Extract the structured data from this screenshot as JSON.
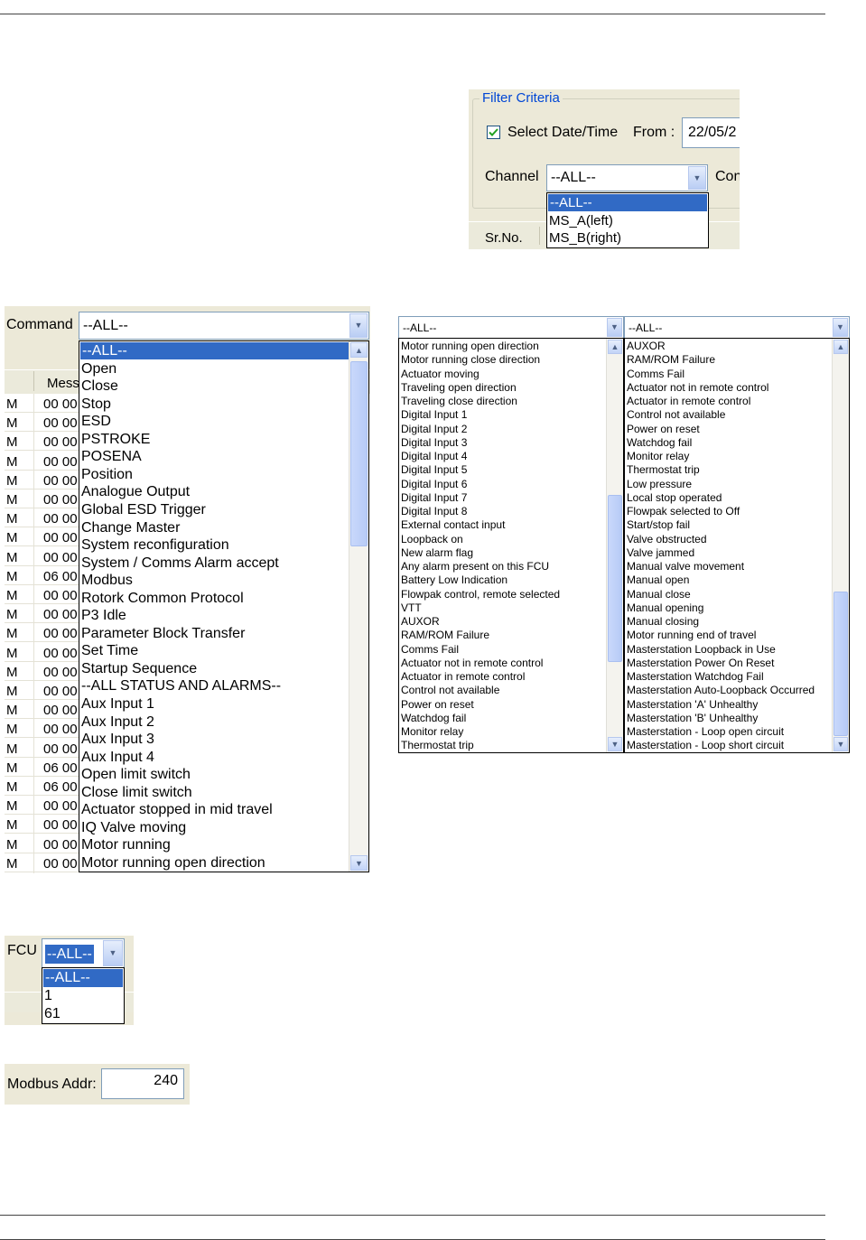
{
  "filter_panel": {
    "group_title": "Filter Criteria",
    "select_date_time_label": "Select Date/Time",
    "select_date_time_checked": true,
    "from_label": "From :",
    "from_value": "22/05/2",
    "channel_label": "Channel",
    "channel_value": "--ALL--",
    "next_label_partial": "Con",
    "channel_options": [
      "--ALL--",
      "MS_A(left)",
      "MS_B(right)"
    ],
    "channel_selected": 0,
    "column_header": "Sr.No."
  },
  "command_panel": {
    "label": "Command",
    "value": "--ALL--",
    "column_header": "Mess",
    "grid_rows": [
      {
        "c1": "M",
        "c2": "00 00"
      },
      {
        "c1": "M",
        "c2": "00 00"
      },
      {
        "c1": "M",
        "c2": "00 00"
      },
      {
        "c1": "M",
        "c2": "00 00"
      },
      {
        "c1": "M",
        "c2": "00 00"
      },
      {
        "c1": "M",
        "c2": "00 00"
      },
      {
        "c1": "M",
        "c2": "00 00"
      },
      {
        "c1": "M",
        "c2": "00 00"
      },
      {
        "c1": "M",
        "c2": "00 00"
      },
      {
        "c1": "M",
        "c2": "06 00"
      },
      {
        "c1": "M",
        "c2": "00 00"
      },
      {
        "c1": "M",
        "c2": "00 00"
      },
      {
        "c1": "M",
        "c2": "00 00"
      },
      {
        "c1": "M",
        "c2": "00 00"
      },
      {
        "c1": "M",
        "c2": "00 00"
      },
      {
        "c1": "M",
        "c2": "00 00"
      },
      {
        "c1": "M",
        "c2": "00 00"
      },
      {
        "c1": "M",
        "c2": "00 00"
      },
      {
        "c1": "M",
        "c2": "00 00"
      },
      {
        "c1": "M",
        "c2": "06 00"
      },
      {
        "c1": "M",
        "c2": "06 00"
      },
      {
        "c1": "M",
        "c2": "00 00"
      },
      {
        "c1": "M",
        "c2": "00 00"
      },
      {
        "c1": "M",
        "c2": "00 00"
      },
      {
        "c1": "M",
        "c2": "00 00"
      }
    ],
    "options": [
      "--ALL--",
      "Open",
      "Close",
      "Stop",
      "ESD",
      "PSTROKE",
      "POSENA",
      "Position",
      "Analogue Output",
      "Global ESD Trigger",
      "Change Master",
      "System reconfiguration",
      "System / Comms Alarm accept",
      "Modbus",
      "Rotork Common Protocol",
      "P3 Idle",
      "Parameter Block Transfer",
      "Set Time",
      "Startup Sequence",
      "--ALL STATUS AND ALARMS--",
      "Aux Input 1",
      "Aux Input 2",
      "Aux Input 3",
      "Aux Input 4",
      "Open limit switch",
      "Close limit switch",
      "Actuator stopped in mid travel",
      "IQ Valve moving",
      "Motor running",
      "Motor running open direction"
    ],
    "selected": 0
  },
  "status_list_1": {
    "value": "--ALL--",
    "options": [
      "Motor running open direction",
      "Motor running close direction",
      "Actuator moving",
      "Traveling open direction",
      "Traveling close direction",
      "Digital Input 1",
      "Digital Input 2",
      "Digital Input 3",
      "Digital Input 4",
      "Digital Input 5",
      "Digital Input 6",
      "Digital Input 7",
      "Digital Input 8",
      "External contact input",
      "Loopback on",
      "New alarm flag",
      "Any alarm present on this FCU",
      "Battery Low Indication",
      "Flowpak control, remote selected",
      "VTT",
      "AUXOR",
      "RAM/ROM Failure",
      "Comms Fail",
      "Actuator not in remote control",
      "Actuator in remote control",
      "Control not available",
      "Power on reset",
      "Watchdog fail",
      "Monitor relay",
      "Thermostat trip"
    ]
  },
  "status_list_2": {
    "value": "--ALL--",
    "options": [
      "AUXOR",
      "RAM/ROM Failure",
      "Comms Fail",
      "Actuator not in remote control",
      "Actuator in remote control",
      "Control not available",
      "Power on reset",
      "Watchdog fail",
      "Monitor relay",
      "Thermostat trip",
      "Low pressure",
      "Local stop operated",
      "Flowpak selected to Off",
      "Start/stop fail",
      "Valve obstructed",
      "Valve jammed",
      "Manual valve movement",
      "Manual open",
      "Manual close",
      "Manual opening",
      "Manual closing",
      "Motor running end of travel",
      "Masterstation Loopback in Use",
      "Masterstation Power On Reset",
      "Masterstation Watchdog Fail",
      "Masterstation Auto-Loopback Occurred",
      "Masterstation 'A' Unhealthy",
      "Masterstation 'B' Unhealthy",
      "Masterstation - Loop open circuit",
      "Masterstation - Loop short circuit"
    ]
  },
  "fcu_panel": {
    "label": "FCU",
    "value": "--ALL--",
    "options": [
      "--ALL--",
      "1",
      "61"
    ],
    "selected": 0
  },
  "modbus_panel": {
    "label": "Modbus Addr:",
    "value": "240"
  }
}
